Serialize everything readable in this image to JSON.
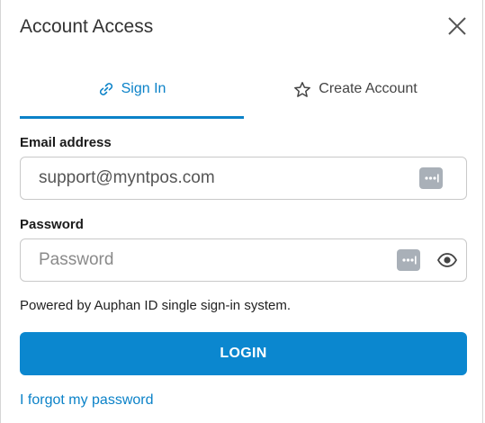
{
  "dialog": {
    "title": "Account Access",
    "close_icon": "close-icon"
  },
  "tabs": [
    {
      "label": "Sign In",
      "icon": "link-icon",
      "active": true
    },
    {
      "label": "Create Account",
      "icon": "star-icon",
      "active": false
    }
  ],
  "form": {
    "email_label": "Email address",
    "email_value": "support@myntpos.com",
    "password_label": "Password",
    "password_placeholder": "Password",
    "password_manager_icon": "password-manager-icon",
    "show_password_icon": "eye-icon"
  },
  "powered_text": "Powered by Auphan ID single sign-in system.",
  "login_label": "LOGIN",
  "forgot_label": "I forgot my password",
  "colors": {
    "accent": "#0b82c8",
    "button": "#0b87cf"
  }
}
